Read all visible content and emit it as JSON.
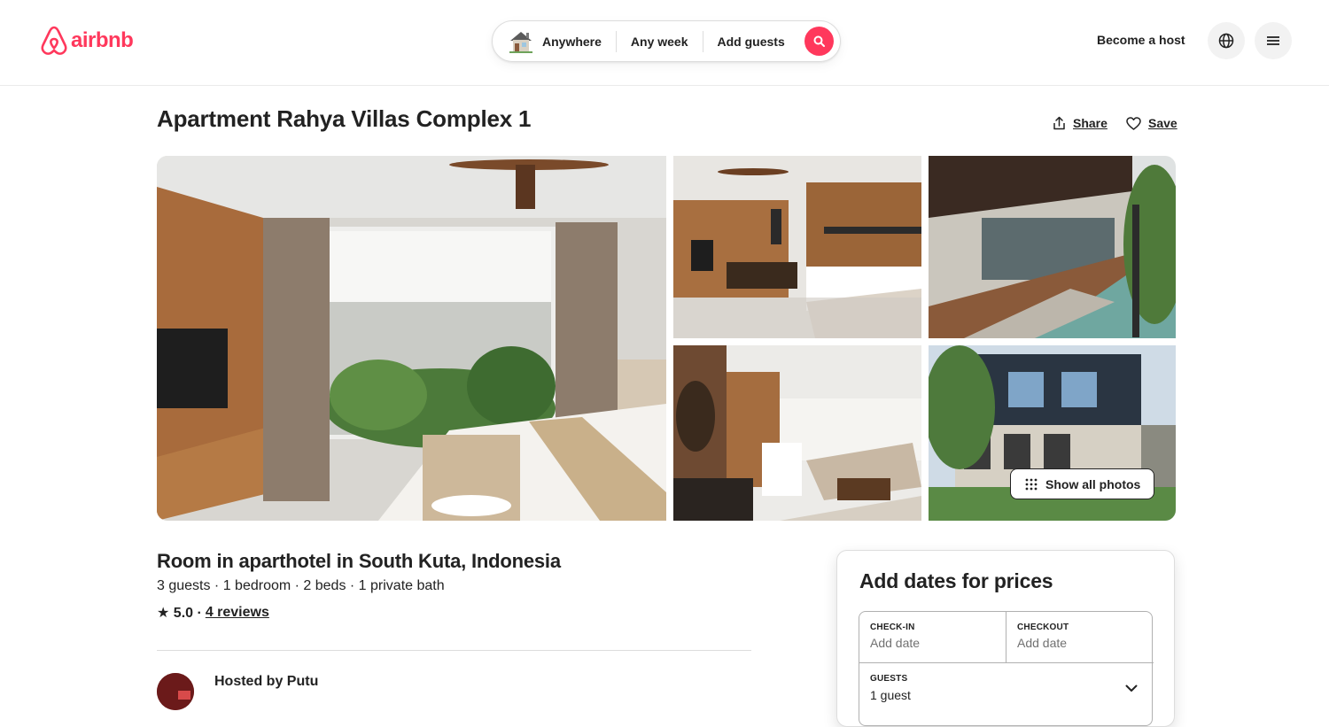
{
  "brand": {
    "name": "airbnb",
    "color": "#ff385c"
  },
  "search": {
    "location": "Anywhere",
    "dates": "Any week",
    "guests": "Add guests"
  },
  "header": {
    "become_host": "Become a host",
    "globe_icon": "globe-icon",
    "menu_icon": "hamburger-menu-icon"
  },
  "listing": {
    "title": "Apartment Rahya Villas Complex 1",
    "share": "Share",
    "save": "Save",
    "show_all_photos": "Show all photos",
    "room_title": "Room in aparthotel in South Kuta, Indonesia",
    "details": "3 guests · 1 bedroom · 2 beds · 1 private bath",
    "rating": "★ 5.0 ·",
    "reviews": "4 reviews",
    "hosted_by": "Hosted by Putu"
  },
  "booking": {
    "title": "Add dates for prices",
    "checkin_label": "CHECK-IN",
    "checkin_value": "Add date",
    "checkout_label": "CHECKOUT",
    "checkout_value": "Add date",
    "guests_label": "GUESTS",
    "guests_value": "1 guest"
  }
}
